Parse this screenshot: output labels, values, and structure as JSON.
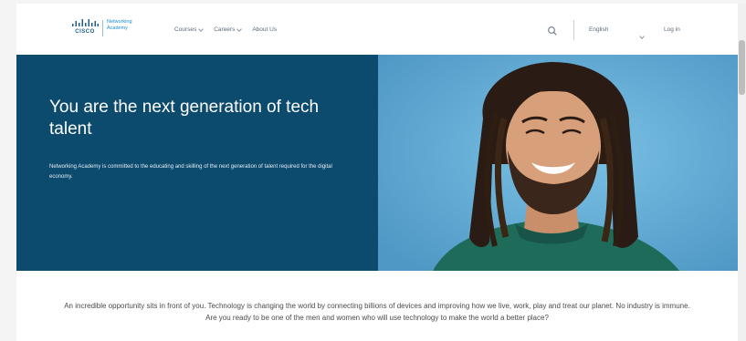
{
  "brand": {
    "company": "CISCO",
    "product_line1": "Networking",
    "product_line2": "Academy"
  },
  "nav": {
    "items": [
      {
        "label": "Courses"
      },
      {
        "label": "Careers"
      },
      {
        "label": "About Us"
      }
    ]
  },
  "header": {
    "search_icon": "search-icon",
    "language": "English",
    "login": "Log in"
  },
  "hero": {
    "title": "You are the next generation of tech talent",
    "subtitle": "Networking Academy is committed to the educating and skilling of the next generation of talent required for the digital economy.",
    "background_color": "#0c4a6e",
    "photo_bg": "#6ab0d6"
  },
  "intro": {
    "text": "An incredible opportunity sits in front of you. Technology is changing the world by connecting billions of devices and improving how we live, work, play and treat our planet. No industry is immune. Are you ready to be one of the men and women who will use technology to make the world a better place?"
  }
}
